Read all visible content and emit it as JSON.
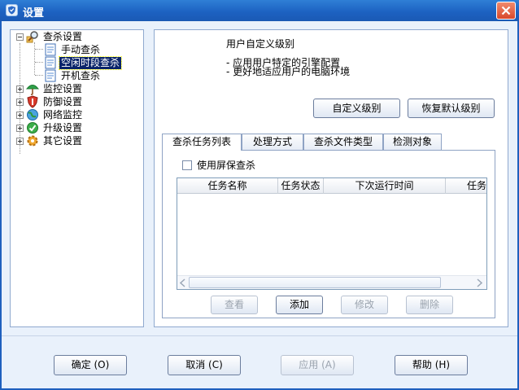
{
  "window": {
    "title": "设置"
  },
  "tree": {
    "scan_settings": "查杀设置",
    "manual_scan": "手动查杀",
    "idle_scan": "空闲时段查杀",
    "boot_scan": "开机查杀",
    "monitor_settings": "监控设置",
    "defense_settings": "防御设置",
    "network_monitor": "网络监控",
    "upgrade_settings": "升级设置",
    "other_settings": "其它设置"
  },
  "content": {
    "level_title": "用户自定义级别",
    "level_desc_1": "- 应用用户特定的引擎配置",
    "level_desc_2": "- 更好地适应用户的电脑环境",
    "custom_level_button": "自定义级别",
    "restore_default_button": "恢复默认级别",
    "tabs": [
      "查杀任务列表",
      "处理方式",
      "查杀文件类型",
      "检测对象"
    ],
    "use_screensaver_label": "使用屏保查杀",
    "columns": [
      "任务名称",
      "任务状态",
      "下次运行时间",
      "任务"
    ],
    "actions": {
      "view": "查看",
      "add": "添加",
      "modify": "修改",
      "delete": "删除"
    }
  },
  "footer": {
    "ok": "确定 (O)",
    "cancel": "取消 (C)",
    "apply": "应用 (A)",
    "help": "帮助 (H)"
  },
  "colors": {
    "titlebar": "#1d62c2",
    "background": "#e9f1fb",
    "selection": "#0a246a"
  }
}
